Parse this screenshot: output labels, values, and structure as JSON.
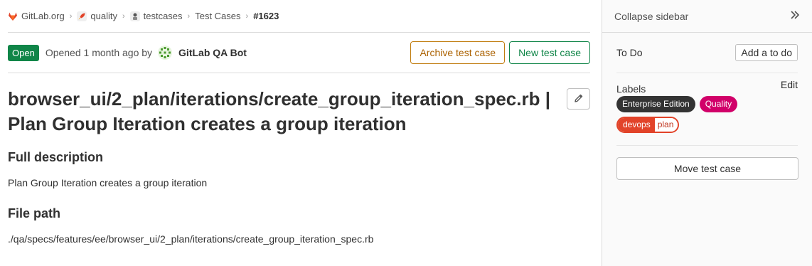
{
  "breadcrumb": [
    {
      "label": "GitLab.org",
      "icon": "gitlab-tanuki-icon"
    },
    {
      "label": "quality",
      "icon": "rocket-icon"
    },
    {
      "label": "testcases",
      "icon": "testcases-avatar-icon"
    },
    {
      "label": "Test Cases"
    },
    {
      "label": "#1623"
    }
  ],
  "header": {
    "status": "Open",
    "opened_text": "Opened 1 month ago by",
    "author": "GitLab QA Bot",
    "archive_label": "Archive test case",
    "new_label": "New test case"
  },
  "title": "browser_ui/2_plan/iterations/create_group_iteration_spec.rb | Plan Group Iteration creates a group iteration",
  "description": {
    "heading": "Full description",
    "text": "Plan Group Iteration creates a group iteration"
  },
  "file_path": {
    "heading": "File path",
    "text": "./qa/specs/features/ee/browser_ui/2_plan/iterations/create_group_iteration_spec.rb"
  },
  "sidebar": {
    "collapse_label": "Collapse sidebar",
    "todo_label": "To Do",
    "todo_button": "Add a to do",
    "labels_heading": "Labels",
    "labels_edit": "Edit",
    "labels": [
      {
        "text": "Enterprise Edition",
        "color": "#333333"
      },
      {
        "text": "Quality",
        "color": "#d10069"
      }
    ],
    "scoped_label": {
      "key": "devops",
      "value": "plan",
      "color": "#e24329"
    },
    "move_button": "Move test case"
  },
  "colors": {
    "status_open": "#108548",
    "archive_border": "#c17d10",
    "new_border": "#108548"
  }
}
